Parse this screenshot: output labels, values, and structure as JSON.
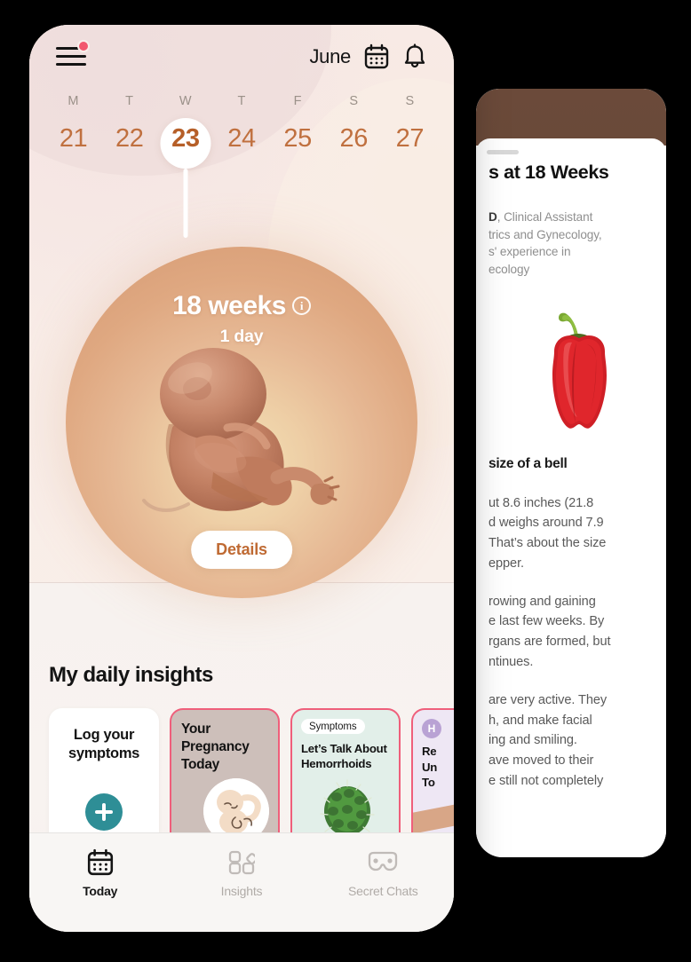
{
  "left_phone": {
    "header": {
      "menu_icon": "hamburger-menu-icon",
      "has_notification_dot": true,
      "month": "June",
      "calendar_icon": "calendar-icon",
      "bell_icon": "bell-icon"
    },
    "week_strip": {
      "days_of_week": [
        "M",
        "T",
        "W",
        "T",
        "F",
        "S",
        "S"
      ],
      "dates": [
        "21",
        "22",
        "23",
        "24",
        "25",
        "26",
        "27"
      ],
      "selected_index": 2
    },
    "progress": {
      "weeks_label": "18 weeks",
      "info_icon": "info-icon",
      "days_label": "1 day",
      "fetus_illustration": "fetus-illustration",
      "details_button": "Details"
    },
    "insights": {
      "section_title": "My daily insights",
      "cards": [
        {
          "name": "log-symptoms",
          "title": "Log your symptoms",
          "badge": "",
          "icon": "plus-icon",
          "bg": "#ffffff",
          "outlined": false
        },
        {
          "name": "pregnancy-today",
          "title": "Your Pregnancy Today",
          "badge": "",
          "icon": "fetus-icon",
          "bg": "#cdbfba",
          "outlined": true
        },
        {
          "name": "hemorrhoids-article",
          "title": "Let's Talk About Hemorrhoids",
          "badge": "Symptoms",
          "icon": "cactus-icon",
          "bg": "#e2efe9",
          "outlined": true
        },
        {
          "name": "relationship-article",
          "title": "Re Un To",
          "badge": "H",
          "icon": "illustration",
          "bg": "#eee7f4",
          "outlined": true
        }
      ]
    },
    "tabbar": {
      "tabs": [
        {
          "label": "Today",
          "icon": "calendar-icon",
          "active": true
        },
        {
          "label": "Insights",
          "icon": "grid-shapes-icon",
          "active": false
        },
        {
          "label": "Secret Chats",
          "icon": "mask-icon",
          "active": false
        }
      ]
    }
  },
  "right_phone": {
    "drag_handle": "sheet-drag-handle",
    "title": "s at 18 Weeks",
    "author_lines": [
      "D, Clinical Assistant",
      "trics and Gynecology,",
      "s' experience in",
      "ecology"
    ],
    "author_bold_prefix": "D",
    "pepper_image": "red-bell-pepper",
    "size_heading": "size of a bell",
    "paragraphs": [
      "ut 8.6 inches (21.8\nd weighs around 7.9\nThat's about the size\nepper.",
      "rowing and gaining\ne last few weeks. By\nrgans are formed, but\nntinues.",
      "are very active. They\nh, and make facial\ning and smiling.\nave moved to their\ne still not completely"
    ]
  },
  "colors": {
    "accent_pink": "#ef5f7b",
    "accent_brown": "#bf6a33",
    "teal": "#2e8e96",
    "date_orange": "#c0703f",
    "background": "#000000"
  }
}
